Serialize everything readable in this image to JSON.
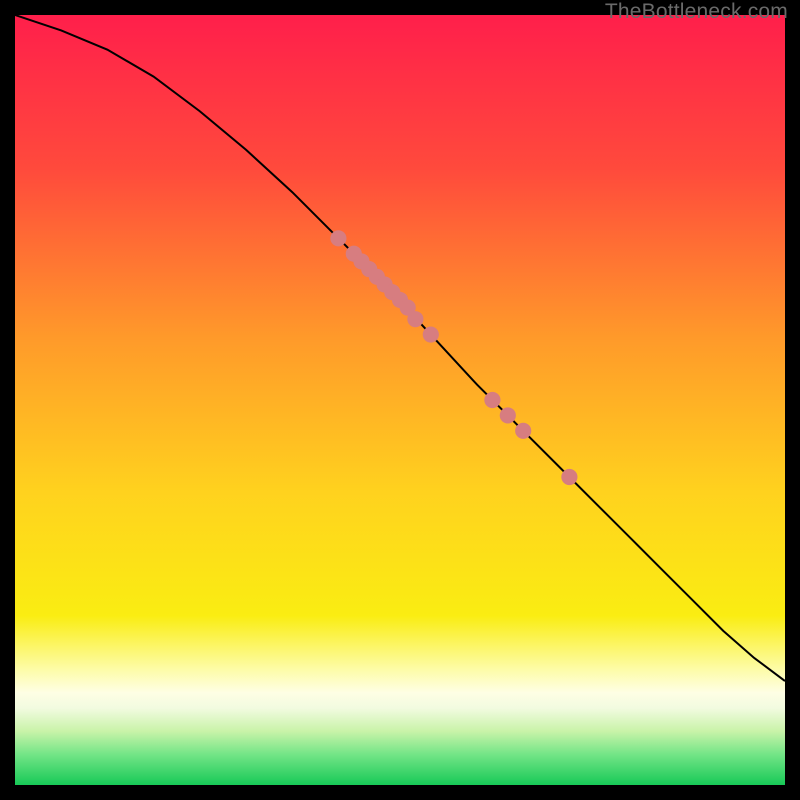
{
  "watermark": "TheBottleneck.com",
  "colors": {
    "point": "#d77d80",
    "curve": "#000000"
  },
  "chart_data": {
    "type": "line",
    "title": "",
    "xlabel": "",
    "ylabel": "",
    "xlim": [
      0,
      100
    ],
    "ylim": [
      0,
      100
    ],
    "curve": {
      "x": [
        0,
        6,
        12,
        18,
        24,
        30,
        36,
        42,
        48,
        54,
        60,
        66,
        72,
        76,
        80,
        84,
        88,
        92,
        96,
        100
      ],
      "y": [
        100,
        98,
        95.5,
        92,
        87.5,
        82.5,
        77,
        71,
        65,
        58.5,
        52,
        46,
        40,
        36,
        32,
        28,
        24,
        20,
        16.5,
        13.5
      ]
    },
    "points": {
      "x": [
        42,
        44,
        45,
        46,
        47,
        48,
        49,
        50,
        51,
        52,
        54,
        62,
        64,
        66,
        72
      ],
      "y": [
        71,
        69,
        68,
        67,
        66,
        65,
        64,
        63,
        62,
        60.5,
        58.5,
        50,
        48,
        46,
        40
      ]
    },
    "gradient_stops": [
      {
        "pct": 0,
        "color": "#ff1f4b"
      },
      {
        "pct": 20,
        "color": "#ff4a3c"
      },
      {
        "pct": 42,
        "color": "#ff9a2a"
      },
      {
        "pct": 62,
        "color": "#ffd21e"
      },
      {
        "pct": 78,
        "color": "#faed12"
      },
      {
        "pct": 85,
        "color": "#fdfca8"
      },
      {
        "pct": 88,
        "color": "#fefee4"
      },
      {
        "pct": 90,
        "color": "#f2fbe0"
      },
      {
        "pct": 93,
        "color": "#c9f3a9"
      },
      {
        "pct": 96,
        "color": "#74e587"
      },
      {
        "pct": 100,
        "color": "#17c957"
      }
    ]
  }
}
